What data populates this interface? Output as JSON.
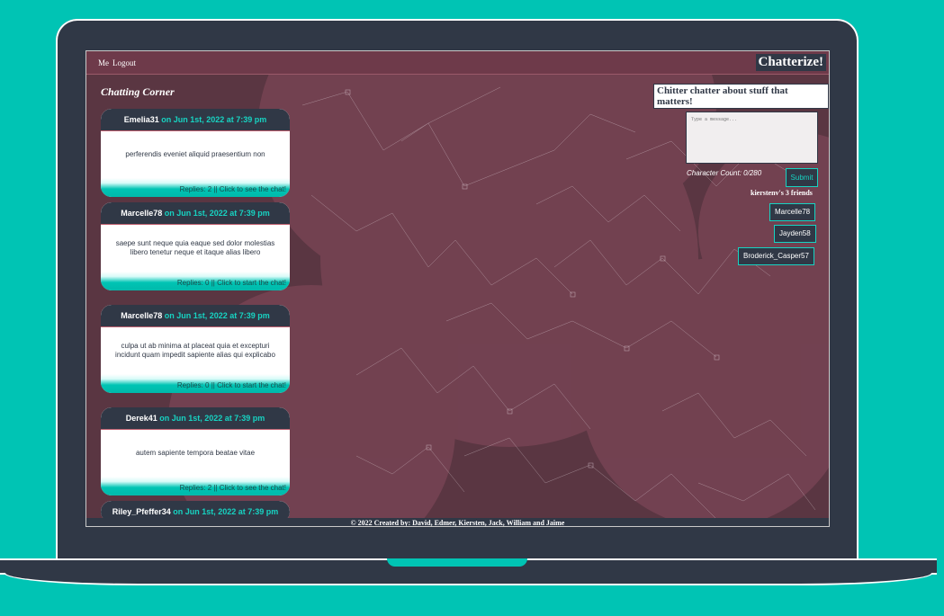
{
  "nav": {
    "me": "Me",
    "logout": "Logout",
    "brand": "Chatterize!"
  },
  "corner_title": "Chatting Corner",
  "tagline": "Chitter chatter about stuff that matters!",
  "posts": [
    {
      "user": "Emelia31",
      "date": " on Jun 1st, 2022 at 7:39 pm",
      "body": "perferendis eveniet aliquid praesentium non",
      "footer": "Replies: 2 || Click to see the chat!"
    },
    {
      "user": "Marcelle78",
      "date": " on Jun 1st, 2022 at 7:39 pm",
      "body": "saepe sunt neque quia eaque sed dolor molestias libero tenetur neque et itaque alias libero",
      "footer": "Replies: 0 || Click to start the chat!"
    },
    {
      "user": "Marcelle78",
      "date": " on Jun 1st, 2022 at 7:39 pm",
      "body": "culpa ut ab minima at placeat quia et excepturi incidunt quam impedit sapiente alias qui explicabo",
      "footer": "Replies: 0 || Click to start the chat!"
    },
    {
      "user": "Derek41",
      "date": " on Jun 1st, 2022 at 7:39 pm",
      "body": "autem sapiente tempora beatae vitae",
      "footer": "Replies: 2 || Click to see the chat!"
    },
    {
      "user": "Riley_Pfeffer34",
      "date": " on Jun 1st, 2022 at 7:39 pm"
    }
  ],
  "composer": {
    "placeholder": "Type a message...",
    "char_count": "Character Count: 0/280",
    "submit": "Submit"
  },
  "friends": {
    "title": "kierstenv's 3 friends",
    "list": [
      "Marcelle78",
      "Jayden58",
      "Broderick_Casper57"
    ]
  },
  "footer": "© 2022 Created by: David, Edmer, Kiersten, Jack, William and Jaime",
  "colors": {
    "teal": "#00c4b4",
    "dark": "#303846",
    "maroon": "#6e3a4a"
  }
}
